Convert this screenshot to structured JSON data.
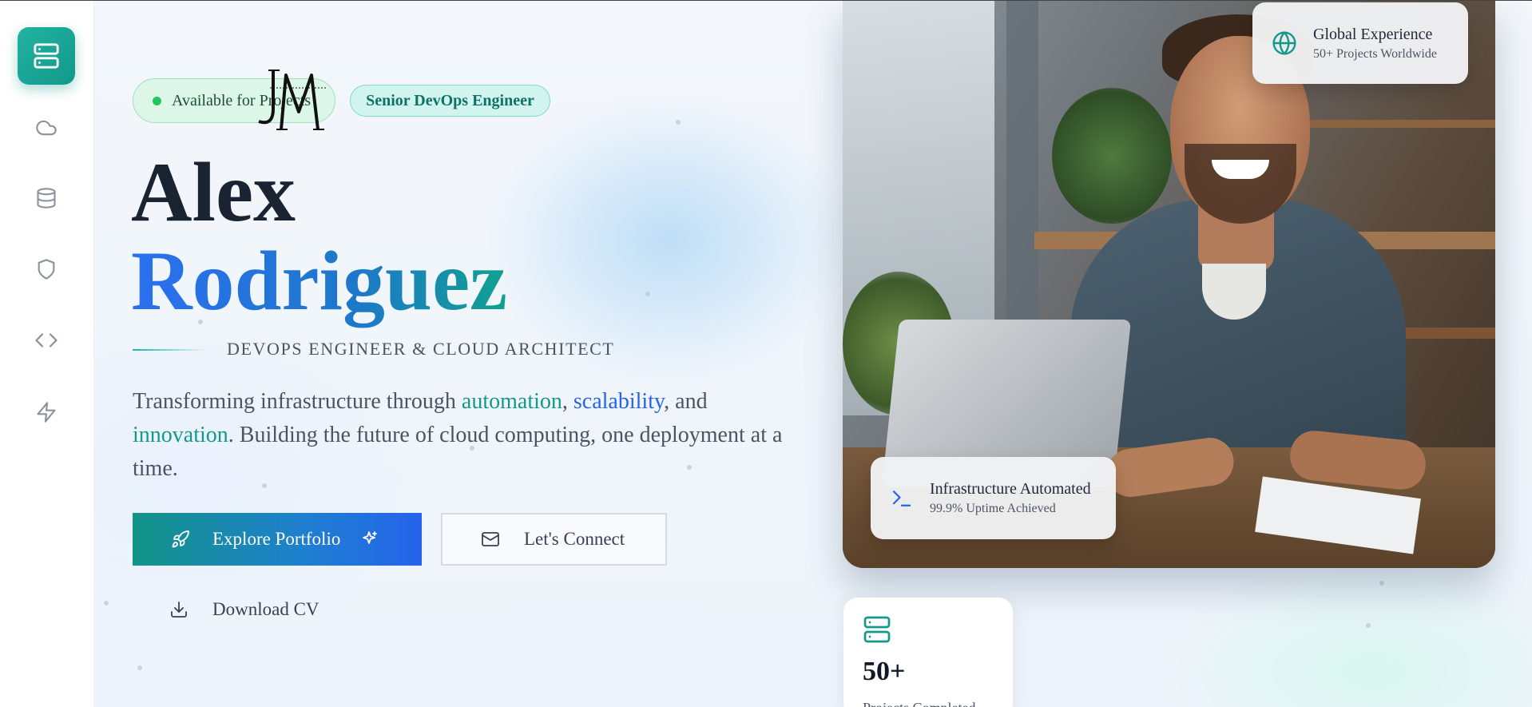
{
  "sidebar": {
    "items": [
      {
        "icon": "server-icon",
        "active": true
      },
      {
        "icon": "cloud-icon",
        "active": false
      },
      {
        "icon": "database-icon",
        "active": false
      },
      {
        "icon": "shield-icon",
        "active": false
      },
      {
        "icon": "code-icon",
        "active": false
      },
      {
        "icon": "zap-icon",
        "active": false
      }
    ]
  },
  "hero": {
    "availability": "Available for Projects",
    "role_badge": "Senior DevOps Engineer",
    "first_name": "Alex",
    "last_name": "Rodriguez",
    "tagline": "DEVOPS ENGINEER & CLOUD ARCHITECT",
    "description": {
      "part1": "Transforming infrastructure through ",
      "hl1": "automation",
      "sep1": ", ",
      "hl2": "scalability",
      "sep2": ", and ",
      "hl3": "innovation",
      "part2": ". Building the future of cloud computing, one deployment at a time."
    }
  },
  "buttons": {
    "explore": "Explore Portfolio",
    "connect": "Let's Connect",
    "download": "Download CV"
  },
  "cards": {
    "global_title": "Global Experience",
    "global_sub": "50+ Projects Worldwide",
    "infra_title": "Infrastructure Automated",
    "infra_sub": "99.9% Uptime Achieved"
  },
  "stats": {
    "projects_value": "50+",
    "projects_label": "Projects Completed"
  },
  "colors": {
    "accent_teal": "#14988a",
    "accent_blue": "#2563eb",
    "name_dark": "#1a2332",
    "available_green": "#22c55e"
  }
}
